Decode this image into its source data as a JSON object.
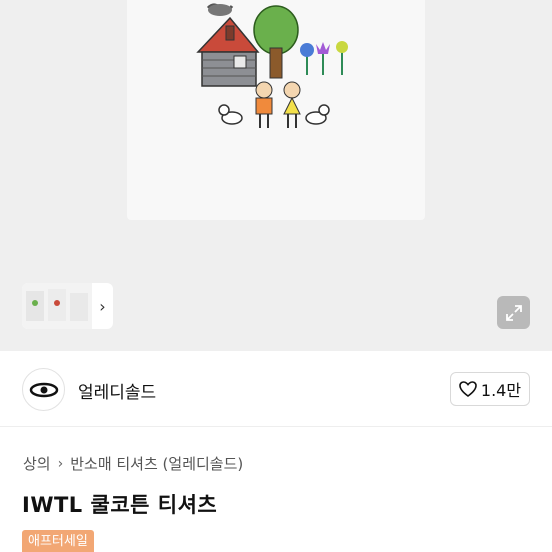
{
  "gallery": {
    "image_alt": "",
    "thumbnail_next": "›"
  },
  "shop": {
    "name": "얼레디솔드",
    "like_count": "1.4만"
  },
  "breadcrumb": {
    "items": [
      "상의",
      "반소매 티셔츠 (얼레디솔드)"
    ],
    "separator": "›"
  },
  "product": {
    "title": "IWTL 쿨코튼 티셔츠",
    "badge": "애프터세일"
  },
  "colors": {
    "badge_bg": "#f2a774",
    "hero_bg": "#efefef"
  },
  "icons": [
    "expand-icon",
    "heart-icon",
    "chevron-right-icon",
    "shop-logo-icon"
  ]
}
